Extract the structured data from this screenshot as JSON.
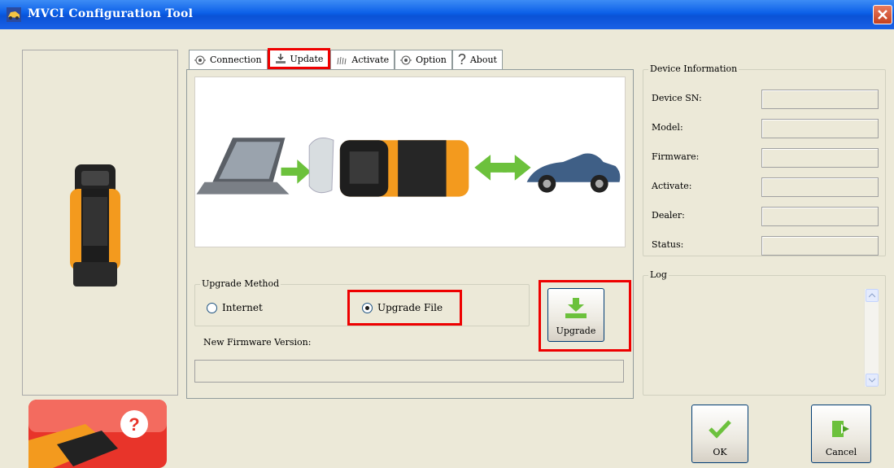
{
  "window": {
    "title": "MVCI Configuration Tool",
    "icon": "app-car-icon",
    "close_icon": "close-icon"
  },
  "tabs": [
    {
      "label": "Connection",
      "icon": "radio-dot-icon",
      "active": false
    },
    {
      "label": "Update",
      "icon": "download-tray-icon",
      "active": true
    },
    {
      "label": "Activate",
      "icon": "grass-icon",
      "active": false
    },
    {
      "label": "Option",
      "icon": "radio-dot-icon",
      "active": false
    },
    {
      "label": "About",
      "icon": "question-mark-icon",
      "active": false
    }
  ],
  "update": {
    "upgrade_method_label": "Upgrade Method",
    "options": [
      {
        "label": "Internet",
        "selected": false
      },
      {
        "label": "Upgrade File",
        "selected": true
      }
    ],
    "new_firmware_label": "New Firmware Version:",
    "upgrade_button": "Upgrade",
    "progress": 0
  },
  "device_info": {
    "title": "Device Information",
    "fields": [
      {
        "label": "Device SN:",
        "value": ""
      },
      {
        "label": "Model:",
        "value": ""
      },
      {
        "label": "Firmware:",
        "value": ""
      },
      {
        "label": "Activate:",
        "value": ""
      },
      {
        "label": "Dealer:",
        "value": ""
      },
      {
        "label": "Status:",
        "value": ""
      }
    ]
  },
  "log": {
    "title": "Log"
  },
  "buttons": {
    "ok": "OK",
    "cancel": "Cancel"
  },
  "colors": {
    "highlight": "#ee0000",
    "device_orange": "#f39a1e",
    "arrow_green": "#6cc13c",
    "title_blue": "#0b5fe8"
  }
}
